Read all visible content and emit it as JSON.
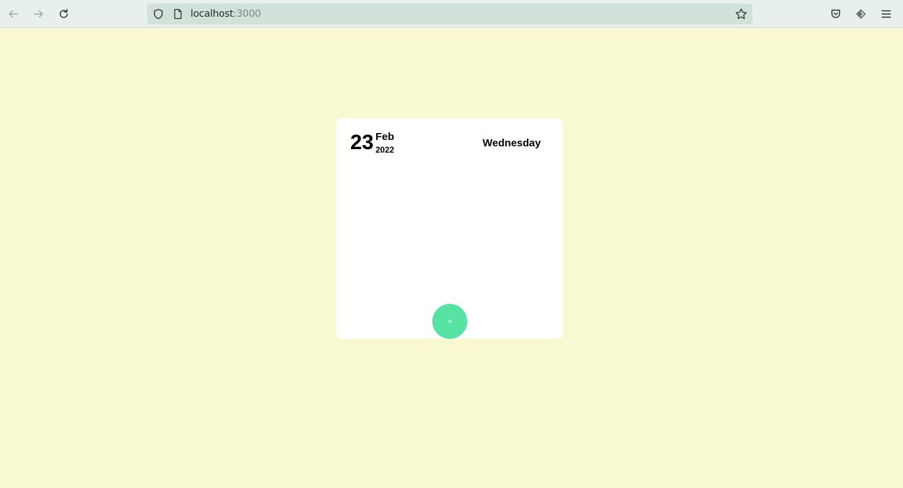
{
  "browser": {
    "url_host": "localhost",
    "url_port": ":3000",
    "icons": [
      "back-arrow-icon",
      "forward-arrow-icon",
      "reload-icon",
      "shield-icon",
      "page-icon",
      "star-icon",
      "pocket-icon",
      "extension-icon",
      "menu-icon"
    ]
  },
  "card": {
    "day": "23",
    "month": "Feb",
    "year": "2022",
    "weekday": "Wednesday",
    "add_label": "+"
  },
  "colors": {
    "page_background": "#f8f9d0",
    "card_background": "#ffffff",
    "add_button": "#55e2a3"
  }
}
